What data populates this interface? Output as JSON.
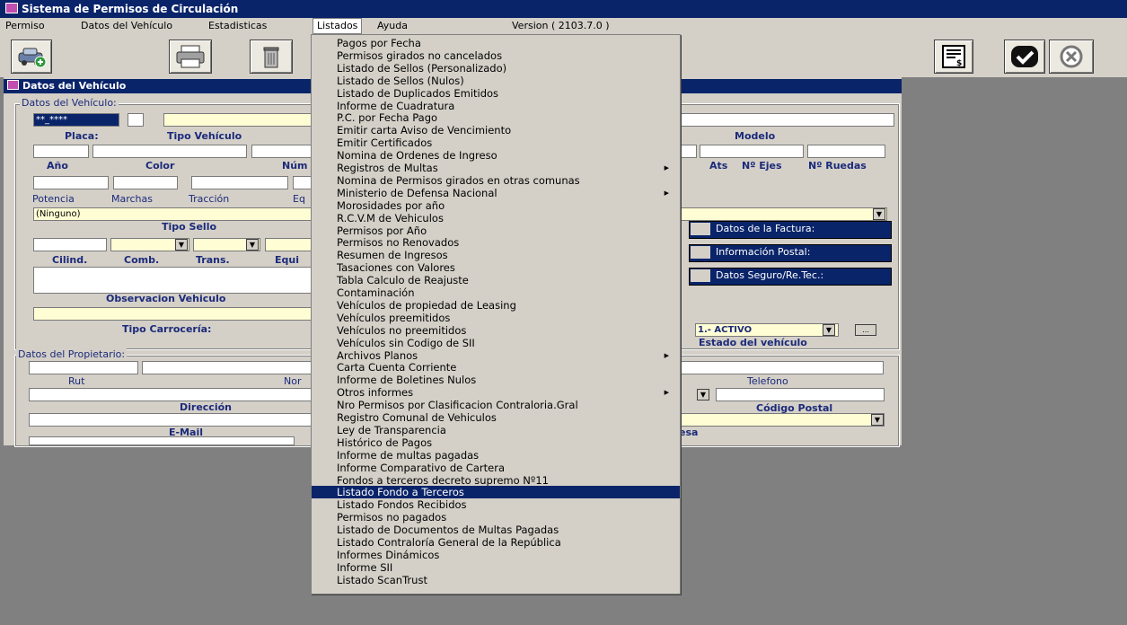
{
  "window": {
    "title": "Sistema de Permisos de Circulación"
  },
  "menubar": {
    "items": [
      "Permiso",
      "Datos del Vehículo",
      "Estadisticas",
      "Listados",
      "Ayuda"
    ],
    "version": "Version ( 2103.7.0 )"
  },
  "panel": {
    "title": "Datos del Vehículo"
  },
  "vehiculo": {
    "legend": "Datos del Vehículo:",
    "placa_value": "**_****",
    "labels": {
      "placa": "Placa:",
      "tipo_vehiculo": "Tipo Vehículo",
      "modelo": "Modelo",
      "anio": "Año",
      "color": "Color",
      "num": "Núm",
      "ats": "Ats",
      "ejes": "Nº Ejes",
      "ruedas": "Nº Ruedas",
      "potencia": "Potencia",
      "marchas": "Marchas",
      "traccion": "Tracción",
      "eq": "Eq",
      "tipo_sello": "Tipo Sello",
      "cilind": "Cilind.",
      "comb": "Comb.",
      "trans": "Trans.",
      "equi": "Equi",
      "observacion": "Observacion Vehiculo",
      "carroceria": "Tipo Carrocería:",
      "estado": "Estado del vehículo"
    },
    "ninguno": "(Ninguno)",
    "estado_value": "1.- ACTIVO",
    "side_buttons": [
      "Datos de la Factura:",
      "Información Postal:",
      "Datos Seguro/Re.Tec.:"
    ]
  },
  "propietario": {
    "legend": "Datos del Propietario:",
    "labels": {
      "rut": "Rut",
      "nom": "Nor",
      "telefono": "Telefono",
      "direccion": "Dirección",
      "cp": "Código Postal",
      "email": "E-Mail",
      "esa": "esa"
    }
  },
  "listados_menu": [
    {
      "label": "Pagos por Fecha"
    },
    {
      "label": "Permisos girados no cancelados"
    },
    {
      "label": "Listado de Sellos (Personalizado)"
    },
    {
      "label": "Listado de Sellos (Nulos)"
    },
    {
      "label": "Listado de Duplicados Emitidos"
    },
    {
      "label": "Informe de Cuadratura"
    },
    {
      "label": "P.C. por Fecha Pago"
    },
    {
      "label": "Emitir carta Aviso de Vencimiento"
    },
    {
      "label": "Emitir Certificados"
    },
    {
      "label": "Nomina de Ordenes de Ingreso"
    },
    {
      "label": "Registros de Multas",
      "sub": true
    },
    {
      "label": "Nomina de Permisos girados en otras comunas"
    },
    {
      "label": "Ministerio de Defensa Nacional",
      "sub": true
    },
    {
      "label": "Morosidades por año"
    },
    {
      "label": "R.C.V.M de Vehiculos"
    },
    {
      "label": "Permisos por Año"
    },
    {
      "label": "Permisos no Renovados"
    },
    {
      "label": "Resumen de Ingresos"
    },
    {
      "label": "Tasaciones con Valores"
    },
    {
      "label": "Tabla Calculo de Reajuste"
    },
    {
      "label": "Contaminación"
    },
    {
      "label": "Vehículos de propiedad de Leasing"
    },
    {
      "label": "Vehículos preemitidos"
    },
    {
      "label": "Vehículos no preemitidos"
    },
    {
      "label": "Vehículos sin Codigo de SII"
    },
    {
      "label": "Archivos Planos",
      "sub": true
    },
    {
      "label": "Carta Cuenta Corriente"
    },
    {
      "label": "Informe de Boletines Nulos"
    },
    {
      "label": "Otros informes",
      "sub": true
    },
    {
      "label": "Nro Permisos por Clasificacion Contraloria.Gral"
    },
    {
      "label": "Registro Comunal de Vehiculos"
    },
    {
      "label": "Ley de Transparencia"
    },
    {
      "label": "Histórico de Pagos"
    },
    {
      "label": "Informe de multas pagadas"
    },
    {
      "label": "Informe Comparativo de Cartera"
    },
    {
      "label": "Fondos a terceros decreto supremo Nº11"
    },
    {
      "label": "Listado Fondo a Terceros",
      "selected": true
    },
    {
      "label": "Listado Fondos Recibidos"
    },
    {
      "label": "Permisos no pagados"
    },
    {
      "label": "Listado de Documentos de Multas Pagadas"
    },
    {
      "label": "Listado Contraloría General de la República"
    },
    {
      "label": "Informes Dinámicos"
    },
    {
      "label": "Informe SII"
    },
    {
      "label": "Listado ScanTrust"
    }
  ]
}
